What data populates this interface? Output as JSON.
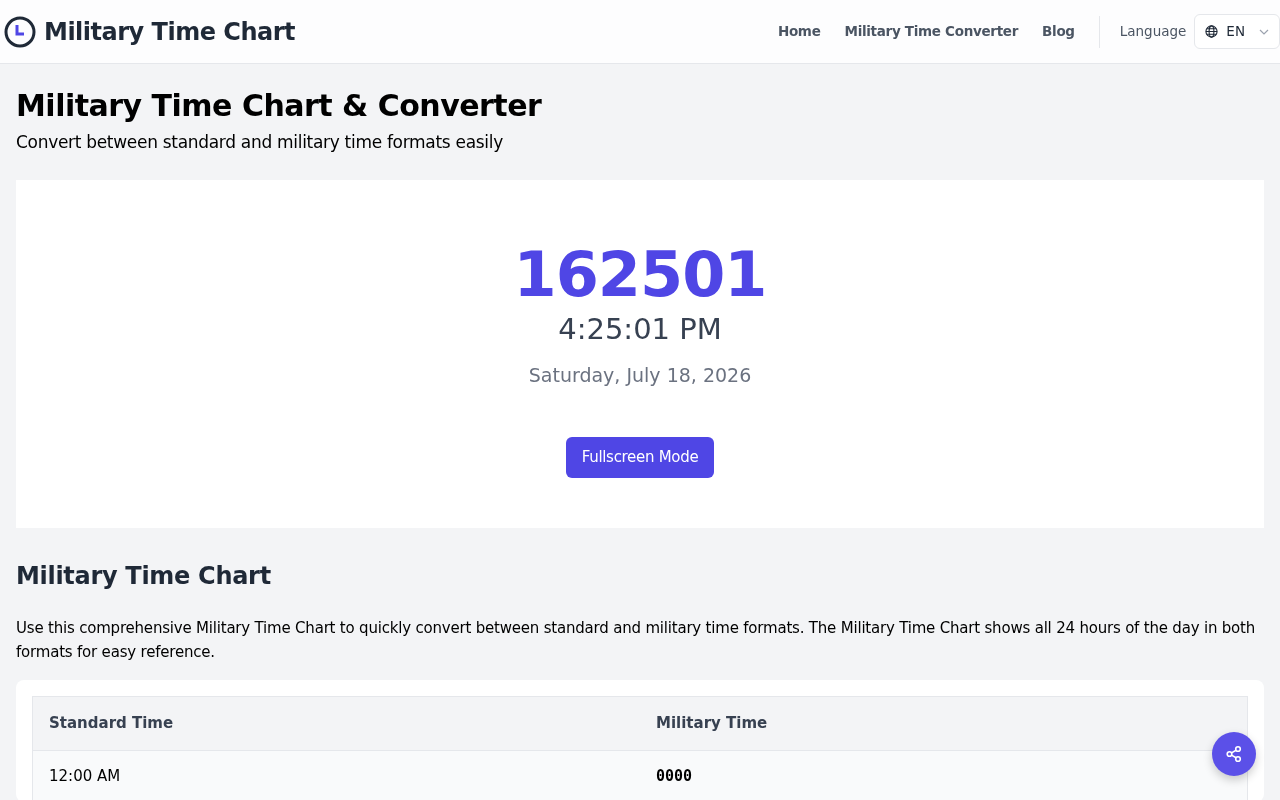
{
  "brand": {
    "title": "Military Time Chart"
  },
  "nav": {
    "links": [
      {
        "label": "Home"
      },
      {
        "label": "Military Time Converter"
      },
      {
        "label": "Blog"
      }
    ],
    "language_label": "Language",
    "language_value": "EN"
  },
  "heading": "Military Time Chart & Converter",
  "subtitle": "Convert between standard and military time formats easily",
  "clock": {
    "military": "162501",
    "standard": "4:25:01 PM",
    "date": "Saturday, July 18, 2026",
    "button": "Fullscreen Mode"
  },
  "chart_section": {
    "title": "Military Time Chart",
    "description": "Use this comprehensive Military Time Chart to quickly convert between standard and military time formats. The Military Time Chart shows all 24 hours of the day in both formats for easy reference."
  },
  "table": {
    "columns": [
      "Standard Time",
      "Military Time"
    ],
    "rows": [
      [
        "12:00 AM",
        "0000"
      ]
    ]
  }
}
